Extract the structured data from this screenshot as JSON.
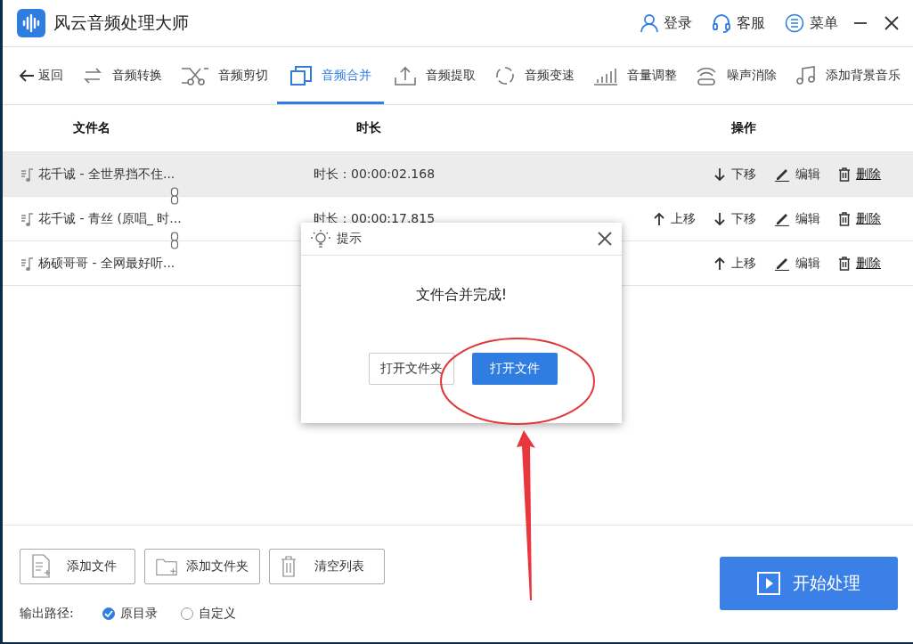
{
  "app_title": "风云音频处理大师",
  "header_actions": [
    {
      "label": "登录"
    },
    {
      "label": "客服"
    },
    {
      "label": "菜单"
    }
  ],
  "back": "返回",
  "tabs": [
    {
      "label": "音频转换",
      "selected": false
    },
    {
      "label": "音频剪切",
      "selected": false
    },
    {
      "label": "音频合并",
      "selected": true
    },
    {
      "label": "音频提取",
      "selected": false
    },
    {
      "label": "音频变速",
      "selected": false
    },
    {
      "label": "音量调整",
      "selected": false
    },
    {
      "label": "噪声消除",
      "selected": false
    },
    {
      "label": "添加背景音乐",
      "selected": false
    }
  ],
  "table": {
    "columns": [
      "文件名",
      "时长",
      "操作"
    ],
    "rows": [
      {
        "name": "花千诚 - 全世界挡不住...",
        "duration": "时长：00:00:02.168",
        "selected": true,
        "linked": true,
        "actions": [
          {
            "kind": "down",
            "label": "下移"
          },
          {
            "kind": "edit",
            "label": "编辑"
          },
          {
            "kind": "delete",
            "label": "删除"
          }
        ]
      },
      {
        "name": "花千诚 - 青丝 (原唱_ 时...",
        "duration": "时长：00:00:17.815",
        "selected": false,
        "linked": true,
        "actions": [
          {
            "kind": "up",
            "label": "上移"
          },
          {
            "kind": "down",
            "label": "下移"
          },
          {
            "kind": "edit",
            "label": "编辑"
          },
          {
            "kind": "delete",
            "label": "删除"
          }
        ]
      },
      {
        "name": "杨硕哥哥 - 全网最好听...",
        "selected": false,
        "linked": false,
        "actions": [
          {
            "kind": "up",
            "label": "上移"
          },
          {
            "kind": "edit",
            "label": "编辑"
          },
          {
            "kind": "delete",
            "label": "删除"
          }
        ]
      }
    ]
  },
  "dialog": {
    "title": "提示",
    "message": "文件合并完成!",
    "buttons": [
      {
        "label": "打开文件夹",
        "kind": "secondary"
      },
      {
        "label": "打开文件",
        "kind": "primary"
      }
    ]
  },
  "bottom_buttons": [
    {
      "label": "添加文件"
    },
    {
      "label": "添加文件夹"
    },
    {
      "label": "清空列表"
    }
  ],
  "output_path": {
    "label": "输出路径:",
    "options": [
      {
        "label": "原目录",
        "selected": true
      },
      {
        "label": "自定义",
        "selected": false
      }
    ]
  },
  "start_button": "开始处理"
}
